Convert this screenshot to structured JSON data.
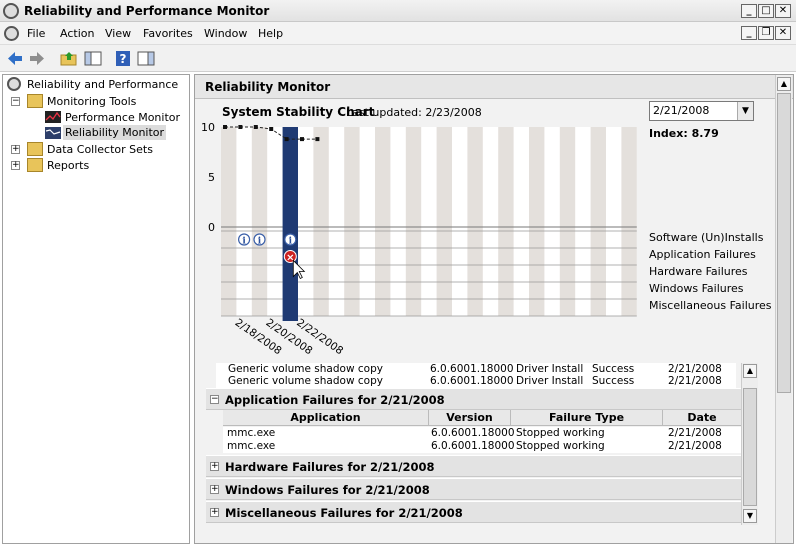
{
  "window": {
    "title": "Reliability and Performance Monitor"
  },
  "menu": {
    "items": [
      "File",
      "Action",
      "View",
      "Favorites",
      "Window",
      "Help"
    ]
  },
  "tree": {
    "root": "Reliability and Performance",
    "monitoring_tools": "Monitoring Tools",
    "performance_monitor": "Performance Monitor",
    "reliability_monitor": "Reliability Monitor",
    "data_collector_sets": "Data Collector Sets",
    "reports": "Reports"
  },
  "panel": {
    "header": "Reliability Monitor"
  },
  "chart": {
    "title": "System Stability Chart",
    "updated": "Last updated: 2/23/2008",
    "selected_date": "2/21/2008",
    "index_label": "Index: 8.79",
    "y_ticks": [
      "10",
      "5",
      "0"
    ],
    "x_ticks": [
      "2/18/2008",
      "2/20/2008",
      "2/22/2008"
    ],
    "categories": [
      "Software (Un)Installs",
      "Application Failures",
      "Hardware Failures",
      "Windows Failures",
      "Miscellaneous Failures"
    ]
  },
  "chart_data": {
    "type": "line",
    "x": [
      "2/17/2008",
      "2/18/2008",
      "2/19/2008",
      "2/20/2008",
      "2/21/2008",
      "2/22/2008",
      "2/23/2008"
    ],
    "values": [
      10,
      10,
      10,
      9.8,
      8.79,
      8.79,
      8.79
    ],
    "ylim": [
      0,
      10
    ],
    "selected": "2/21/2008"
  },
  "details": {
    "install_rows": [
      {
        "name": "Generic volume shadow copy",
        "version": "6.0.6001.18000",
        "activity": "Driver Install",
        "status": "Success",
        "date": "2/21/2008"
      },
      {
        "name": "Generic volume shadow copy",
        "version": "6.0.6001.18000",
        "activity": "Driver Install",
        "status": "Success",
        "date": "2/21/2008"
      }
    ],
    "app_failures": {
      "heading": "Application Failures for 2/21/2008",
      "columns": [
        "Application",
        "Version",
        "Failure Type",
        "Date"
      ],
      "rows": [
        {
          "application": "mmc.exe",
          "version": "6.0.6001.18000",
          "failure": "Stopped working",
          "date": "2/21/2008"
        },
        {
          "application": "mmc.exe",
          "version": "6.0.6001.18000",
          "failure": "Stopped working",
          "date": "2/21/2008"
        }
      ]
    },
    "hardware_heading": "Hardware Failures for 2/21/2008",
    "windows_heading": "Windows Failures for 2/21/2008",
    "misc_heading": "Miscellaneous Failures for 2/21/2008"
  }
}
